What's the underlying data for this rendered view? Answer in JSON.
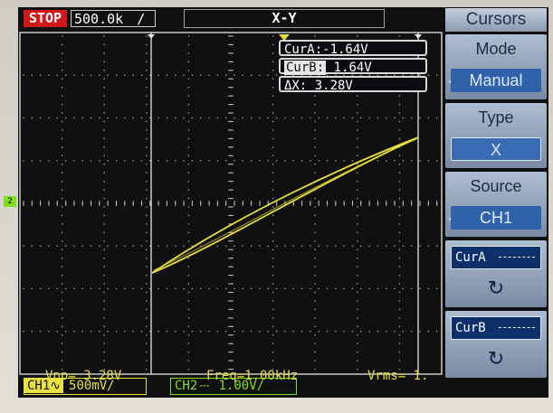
{
  "status": {
    "run_state": "STOP",
    "timebase": "500.0k"
  },
  "display_mode": "X-Y",
  "cursor_readouts": {
    "cur_a": "CurA:-1.64V",
    "cur_b_tag": "CurB:",
    "cur_b_value": " 1.64V",
    "delta": "ΔX: 3.28V"
  },
  "channel_marker": "2",
  "measurements": {
    "vpp": "Vpp= 3.28V",
    "freq": "Freq=1.00kHz",
    "vrms": "Vrms= 1."
  },
  "channels": {
    "ch1_tag": "CH1",
    "ch1_coupling": "∿",
    "ch1_scale": "500mV/",
    "ch2_label": "CH2",
    "ch2_coupling": "⎓",
    "ch2_scale": "1.00V/"
  },
  "menu": {
    "title": "Cursors",
    "mode_label": "Mode",
    "mode_value": "Manual",
    "type_label": "Type",
    "type_value": "X",
    "source_label": "Source",
    "source_value": "CH1",
    "cur_a_button": "CurA",
    "cur_b_button": "CurB",
    "knob_icon": "rotate-knob-icon"
  },
  "colors": {
    "trace": "#e8e040",
    "ch2": "#80e020",
    "stop": "#d01818",
    "menu_active": "#2f62a8"
  }
}
